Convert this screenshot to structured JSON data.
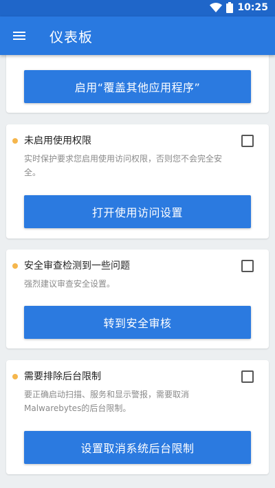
{
  "status_bar": {
    "time": "10:25"
  },
  "app_bar": {
    "title": "仪表板"
  },
  "cards": [
    {
      "button_label": "启用“覆盖其他应用程序”"
    },
    {
      "title": "未启用使用权限",
      "description": "实时保护要求您启用使用访问权限，否则您不会完全安全。",
      "button_label": "打开使用访问设置"
    },
    {
      "title": "安全审查检测到一些问题",
      "description": "强烈建议审查安全设置。",
      "button_label": "转到安全审核"
    },
    {
      "title": "需要排除后台限制",
      "description": "要正确启动扫描、服务和显示警报，需要取消Malwarebytes的后台限制。",
      "button_label": "设置取消系统后台限制"
    }
  ],
  "colors": {
    "app_bar": "#2979e0",
    "status_bar": "#1f66c9",
    "button": "#2b7ae0",
    "warning_dot": "#f5b64c",
    "background": "#eceff1"
  },
  "icons": {
    "wifi": "wifi-icon",
    "battery": "battery-icon",
    "menu": "menu-icon"
  }
}
